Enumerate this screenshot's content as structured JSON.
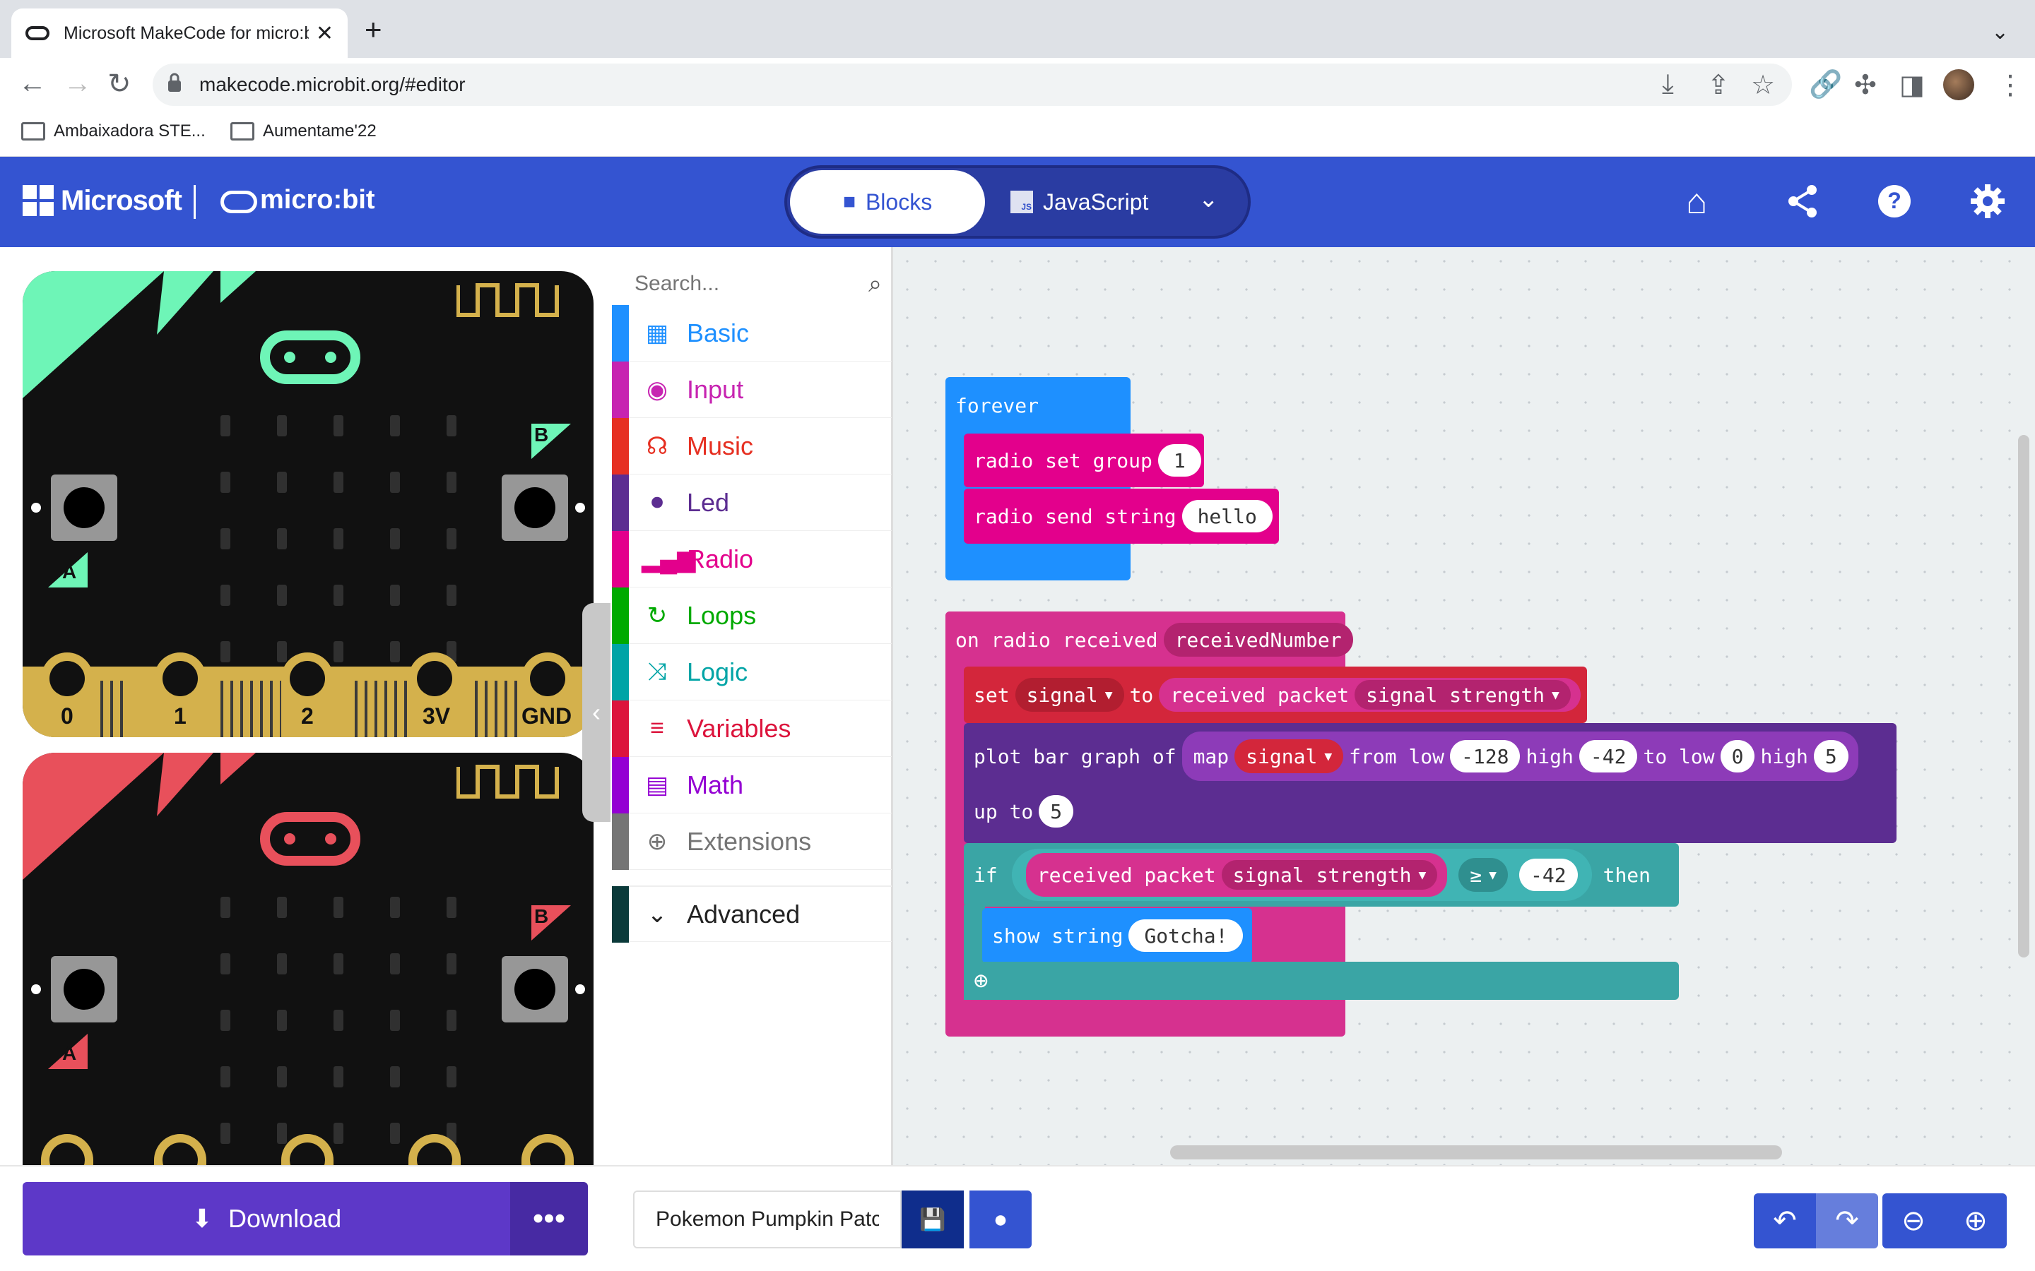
{
  "browser": {
    "tab_title": "Microsoft MakeCode for micro:bit",
    "url": "makecode.microbit.org/#editor",
    "bookmarks": [
      "Ambaixadora STE...",
      "Aumentame'22"
    ]
  },
  "header": {
    "ms_label": "Microsoft",
    "brand_label": "micro:bit",
    "blocks_label": "Blocks",
    "javascript_label": "JavaScript",
    "js_badge": "JS"
  },
  "simulator": {
    "pins": [
      "0",
      "1",
      "2",
      "3V",
      "GND"
    ],
    "button_a": "A",
    "button_b": "B",
    "board1_accent": "#6ef5b7",
    "board2_accent": "#e8505b"
  },
  "toolbox": {
    "search_placeholder": "Search...",
    "categories": [
      {
        "label": "Basic",
        "color": "#1e90ff",
        "icon": "grid-icon"
      },
      {
        "label": "Input",
        "color": "#c724b1",
        "icon": "target-icon"
      },
      {
        "label": "Music",
        "color": "#e63022",
        "icon": "headphones-icon"
      },
      {
        "label": "Led",
        "color": "#5c2d91",
        "icon": "toggle-icon"
      },
      {
        "label": "Radio",
        "color": "#e3008c",
        "icon": "signal-icon"
      },
      {
        "label": "Loops",
        "color": "#00aa00",
        "icon": "refresh-icon"
      },
      {
        "label": "Logic",
        "color": "#00a4a6",
        "icon": "shuffle-icon"
      },
      {
        "label": "Variables",
        "color": "#dc143c",
        "icon": "list-icon"
      },
      {
        "label": "Math",
        "color": "#9400d3",
        "icon": "calculator-icon"
      },
      {
        "label": "Extensions",
        "color": "#757575",
        "icon": "plus-circle-icon"
      }
    ],
    "advanced_label": "Advanced"
  },
  "blocks": {
    "forever": {
      "label": "forever",
      "radio_set_group": "radio set group",
      "group_value": "1",
      "radio_send_string": "radio send string",
      "send_value": "hello"
    },
    "on_received": {
      "label": "on radio received",
      "param": "receivedNumber",
      "set": "set",
      "var_signal": "signal",
      "to": "to",
      "received_packet": "received packet",
      "signal_strength": "signal strength",
      "plot_bar_graph": "plot bar graph of",
      "map": "map",
      "from_low": "from low",
      "from_low_value": "-128",
      "high": "high",
      "from_high_value": "-42",
      "to_low": "to low",
      "to_low_value": "0",
      "to_high_value": "5",
      "up_to": "up to",
      "up_to_value": "5",
      "if": "if",
      "op": "≥",
      "compare_value": "-42",
      "then": "then",
      "show_string": "show string",
      "show_value": "Gotcha!"
    }
  },
  "footer": {
    "download_label": "Download",
    "project_name": "Pokemon Pumpkin Patch"
  }
}
